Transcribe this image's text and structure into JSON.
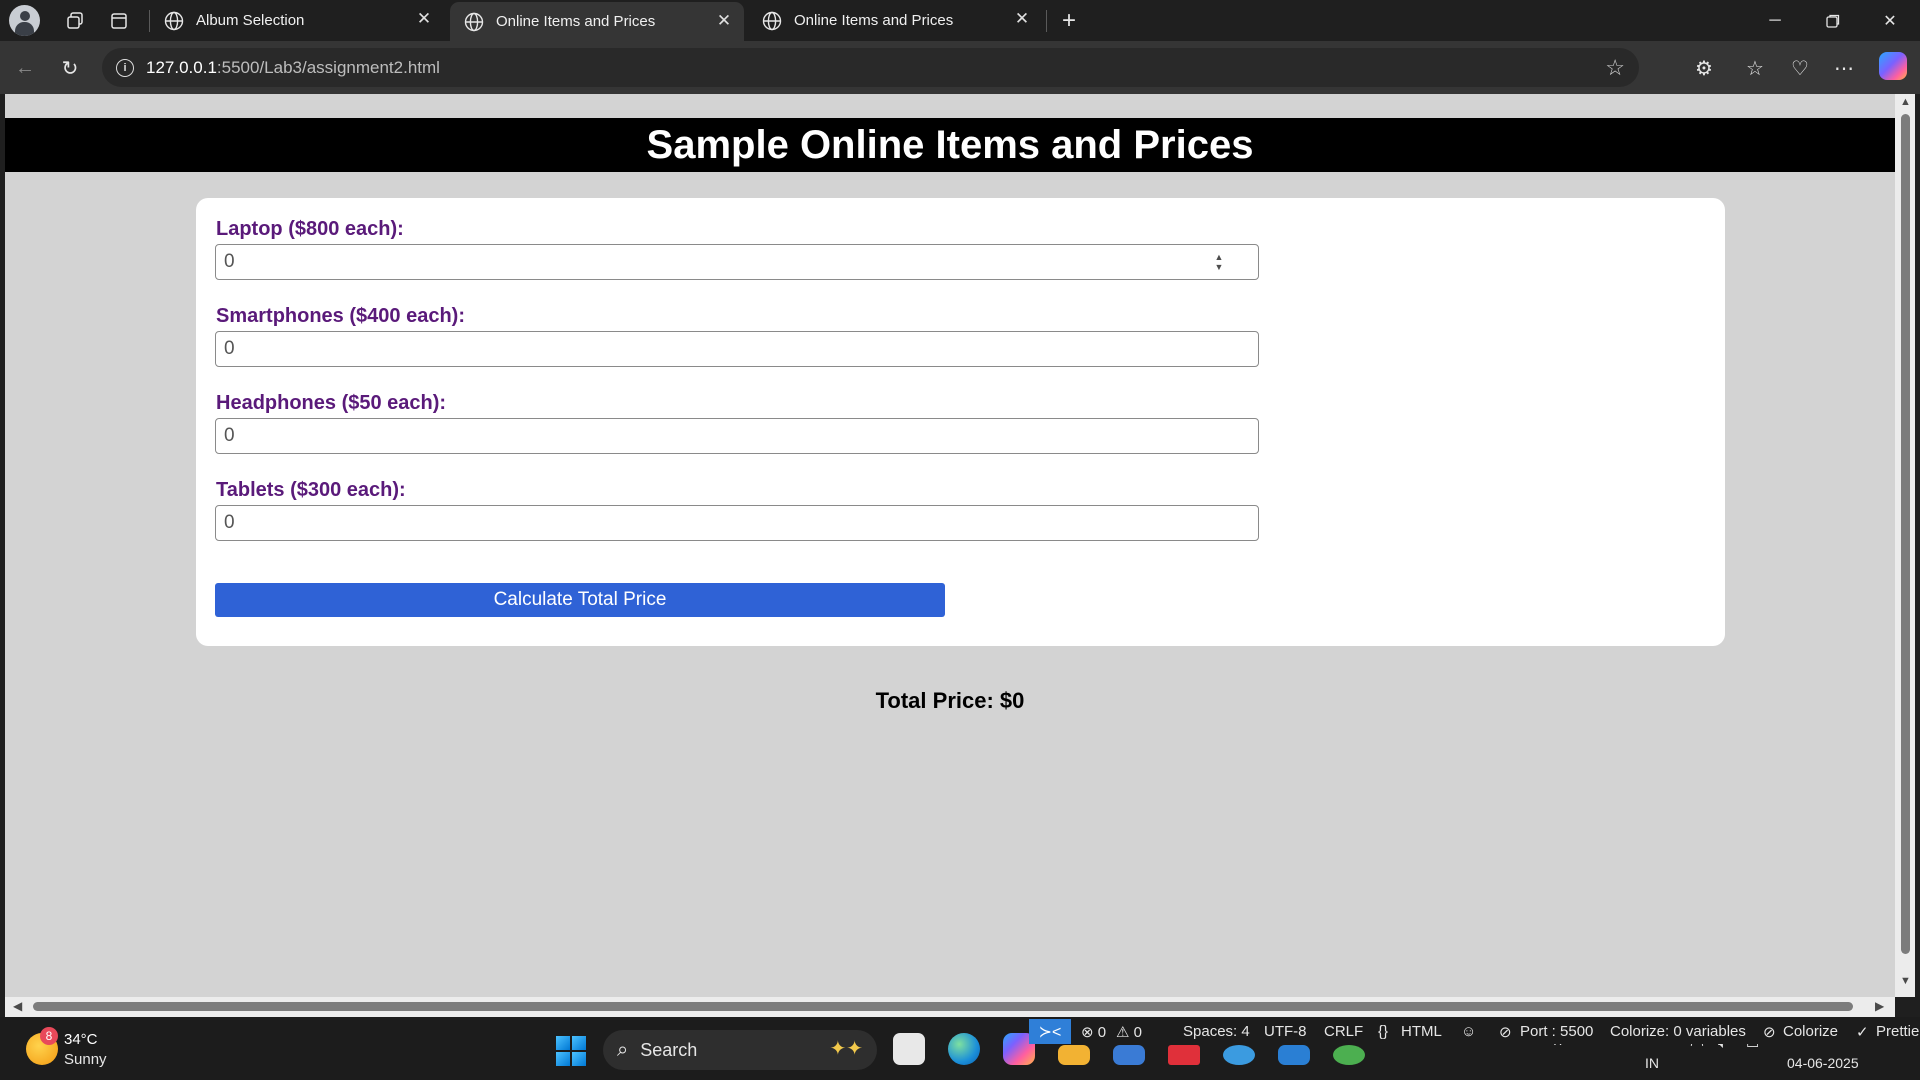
{
  "browser": {
    "tabs": [
      {
        "title": "Album Selection",
        "active": false
      },
      {
        "title": "Online Items and Prices",
        "active": true
      },
      {
        "title": "Online Items and Prices",
        "active": false
      }
    ],
    "url_host": "127.0.0.1",
    "url_path": ":5500/Lab3/assignment2.html"
  },
  "page": {
    "title": "Sample Online Items and Prices",
    "fields": [
      {
        "label": "Laptop ($800 each):",
        "value": "0"
      },
      {
        "label": "Smartphones ($400 each):",
        "value": "0"
      },
      {
        "label": "Headphones ($50 each):",
        "value": "0"
      },
      {
        "label": "Tablets ($300 each):",
        "value": "0"
      }
    ],
    "button_label": "Calculate Total Price",
    "total_text": "Total Price: $0"
  },
  "taskbar": {
    "weather_badge": "8",
    "temperature": "34°C",
    "condition": "Sunny",
    "search_label": "Search",
    "status": {
      "errors": "⊗ 0",
      "warnings": "⚠ 0",
      "spaces": "Spaces: 4",
      "encoding": "UTF-8",
      "eol": "CRLF",
      "language": "HTML",
      "port": "Port : 5500",
      "colorize_vars": "Colorize: 0 variables",
      "colorize": "Colorize",
      "prettier": "Prettie"
    },
    "lang": "IN",
    "date": "04-06-2025"
  },
  "colors": {
    "header_bg": "#000000",
    "label": "#5a1a7a",
    "button": "#2f62d6",
    "page_bg": "#d3d3d3"
  }
}
